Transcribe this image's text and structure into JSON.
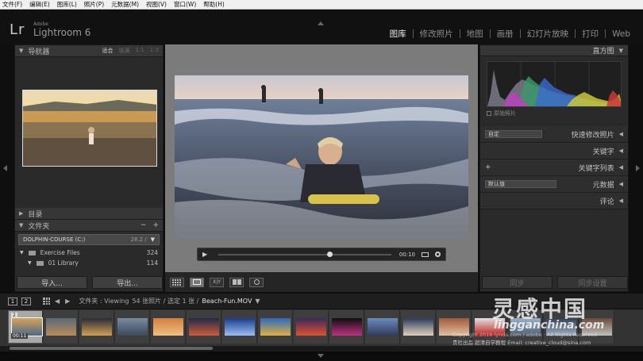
{
  "menubar": {
    "items": [
      "文件(F)",
      "编辑(E)",
      "图库(L)",
      "照片(P)",
      "元数据(M)",
      "视图(V)",
      "窗口(W)",
      "帮助(H)"
    ]
  },
  "identity": {
    "lr": "Lr",
    "adobe": "Adobe",
    "product": "Lightroom 6"
  },
  "modules": {
    "items": [
      "图库",
      "修改照片",
      "地图",
      "画册",
      "幻灯片放映",
      "打印",
      "Web"
    ],
    "active_index": 0
  },
  "left_panel": {
    "navigator": {
      "title": "导航器",
      "options": [
        "适合",
        "填满",
        "1:1",
        "1:3"
      ],
      "active_option": "适合"
    },
    "catalog_title": "目录",
    "folders": {
      "title": "文件夹",
      "add": "+",
      "remove": "−",
      "volume_name": "DOLPHIN-COURSE (C:)",
      "volume_size": "28.2 /",
      "rows": [
        {
          "name": "Exercise Files",
          "count": "324"
        },
        {
          "name": "01 Library",
          "count": "114"
        }
      ]
    },
    "import_label": "导入...",
    "export_label": "导出..."
  },
  "video": {
    "timecode": "00:10",
    "progress": 0.63
  },
  "right_panel": {
    "histogram_title": "直方图",
    "original_photo": "原始照片",
    "quick_develop": {
      "preset": "自定",
      "title": "快速修改照片"
    },
    "keywording": "关键字",
    "keyword_list": {
      "add": "+",
      "title": "关键字列表"
    },
    "metadata": {
      "preset": "默认值",
      "title": "元数据"
    },
    "comments": "评论",
    "sync_label": "同步",
    "sync_settings_label": "同步设置"
  },
  "filmstrip_header": {
    "screen1": "1",
    "screen2": "2",
    "prefix": "文件夹 : Viewing",
    "summary": "54 张照片 / 选定 1 张 /",
    "filename": "Beach-Fun.MOV"
  },
  "filmstrip": {
    "selected_number": "2",
    "selected_duration": "00:11",
    "thumb_colors": [
      [
        "#d9a25a",
        "#4a6a8a"
      ],
      [
        "#5a6a7a",
        "#b88a5a"
      ],
      [
        "#2a2a3a",
        "#d0a050"
      ],
      [
        "#7a8aa0",
        "#3a4a5a"
      ],
      [
        "#d08040",
        "#f0c080"
      ],
      [
        "#202a4a",
        "#d05a3a"
      ],
      [
        "#1a3a8a",
        "#9ac0f0"
      ],
      [
        "#2a6ac0",
        "#e0b040"
      ],
      [
        "#3a2a5a",
        "#e05030"
      ],
      [
        "#101010",
        "#c03080"
      ],
      [
        "#6a8ac0",
        "#303a5a"
      ],
      [
        "#2a3a5a",
        "#e0d0c0"
      ],
      [
        "#a05a3a",
        "#e0c0a0"
      ],
      [
        "#e0e0e0",
        "#c02020"
      ],
      [
        "#9ab0c8",
        "#506070"
      ],
      [
        "#304050",
        "#a0b0c0"
      ],
      [
        "#6a4a3a",
        "#c0c0c0"
      ]
    ]
  },
  "watermark": {
    "title": "灵感中国",
    "url": "lingganchina.com",
    "line1": "Copyright 2016 lynda.com / adobe · All Rights Reserved",
    "line2": "贵社出品  超清自学教程 Email: creative_cloud@sina.com"
  },
  "colors": {
    "panel": "#2a2a2a",
    "panel_header": "#363636",
    "center_bg": "#7b7b7b",
    "active_module": "#eaeaea",
    "menubar": "#f0f0f0"
  }
}
